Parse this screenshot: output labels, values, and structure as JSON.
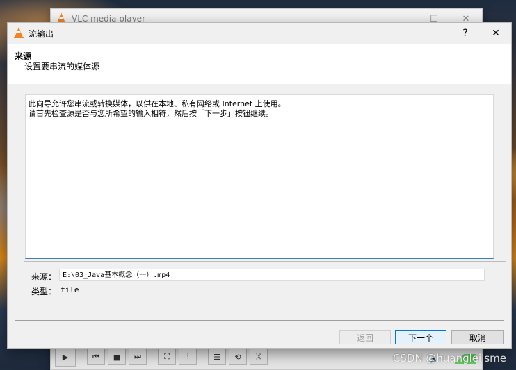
{
  "background_window": {
    "title": "VLC media player",
    "controls": {
      "minimize": "—",
      "maximize": "☐",
      "close": "✕"
    }
  },
  "dialog": {
    "title": "流输出",
    "help": "?",
    "close": "✕",
    "header_title": "来源",
    "header_subtitle": "设置要串流的媒体源",
    "description_lines": [
      "此向导允许您串流或转换媒体，以供在本地、私有网络或 Internet 上使用。",
      "请首先检查源是否与您所希望的输入相符，然后按「下一步」按钮继续。"
    ],
    "source_label": "来源：",
    "source_value": "E:\\03_Java基本概念（一）.mp4",
    "type_label": "类型：",
    "type_value": "file",
    "buttons": {
      "back": "返回",
      "next": "下一个",
      "cancel": "取消"
    }
  },
  "watermark": "CSDN @huangleilsme",
  "colors": {
    "accent": "#0078d7",
    "vlc_orange": "#f58220"
  }
}
